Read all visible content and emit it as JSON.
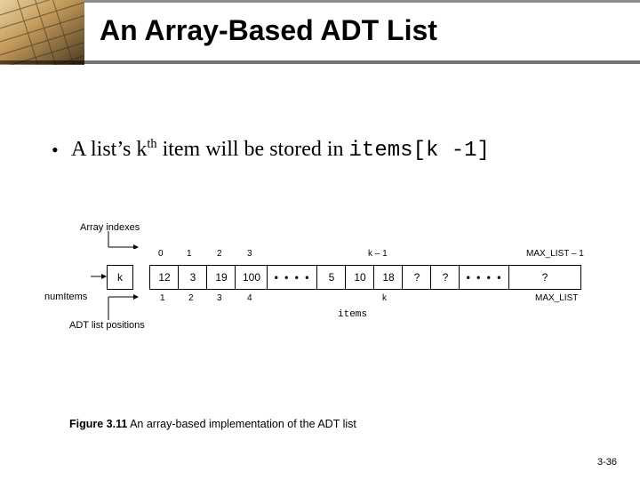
{
  "title": "An Array-Based ADT List",
  "bullet": {
    "pre": "A list’s k",
    "sup": "th",
    "mid": " item will be stored in ",
    "code1": "items[k -1]"
  },
  "figure": {
    "label_array_indexes": "Array indexes",
    "label_numItems": "numItems",
    "label_adt_positions": "ADT list positions",
    "array_name": "items",
    "numItems_box": "k",
    "indexes": [
      "0",
      "1",
      "2",
      "3",
      "",
      "k – 1",
      "",
      "MAX_LIST – 1"
    ],
    "positions": [
      "1",
      "2",
      "3",
      "4",
      "",
      "k",
      "",
      "MAX_LIST"
    ],
    "cells": [
      "12",
      "3",
      "19",
      "100",
      "• • • •",
      "5",
      "10",
      "18",
      "?",
      "?",
      "• • • •",
      "?"
    ]
  },
  "caption": {
    "bold": "Figure 3.11",
    "rest": "  An array-based implementation of the ADT list"
  },
  "pagenum": "3-36"
}
